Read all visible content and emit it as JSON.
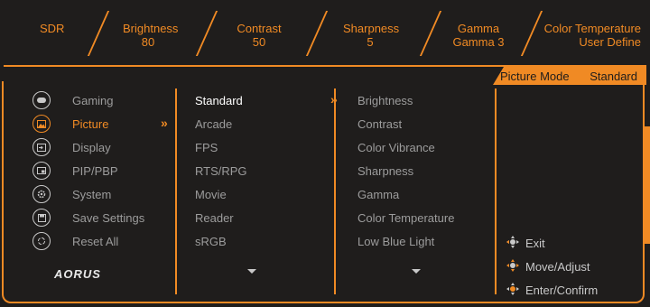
{
  "top_status": {
    "mode": "SDR",
    "items": [
      {
        "label": "Brightness",
        "value": "80"
      },
      {
        "label": "Contrast",
        "value": "50"
      },
      {
        "label": "Sharpness",
        "value": "5"
      },
      {
        "label": "Gamma",
        "value": "Gamma 3"
      },
      {
        "label": "Color Temperature",
        "value": "User Define"
      }
    ]
  },
  "picture_mode": {
    "label": "Picture Mode",
    "value": "Standard"
  },
  "menu": [
    {
      "label": "Gaming",
      "icon": "gamepad-icon"
    },
    {
      "label": "Picture",
      "icon": "picture-icon"
    },
    {
      "label": "Display",
      "icon": "display-input-icon"
    },
    {
      "label": "PIP/PBP",
      "icon": "pip-icon"
    },
    {
      "label": "System",
      "icon": "gear-icon"
    },
    {
      "label": "Save Settings",
      "icon": "save-icon"
    },
    {
      "label": "Reset All",
      "icon": "reset-icon"
    }
  ],
  "modes": [
    "Standard",
    "Arcade",
    "FPS",
    "RTS/RPG",
    "Movie",
    "Reader",
    "sRGB"
  ],
  "settings": [
    "Brightness",
    "Contrast",
    "Color Vibrance",
    "Sharpness",
    "Gamma",
    "Color Temperature",
    "Low Blue Light"
  ],
  "help": [
    {
      "label": "Exit"
    },
    {
      "label": "Move/Adjust"
    },
    {
      "label": "Enter/Confirm"
    }
  ],
  "logo": "AORUS",
  "colors": {
    "accent": "#f08a24",
    "background": "#1f1d1c",
    "text": "#9c9c9c",
    "selected": "#ffffff"
  }
}
